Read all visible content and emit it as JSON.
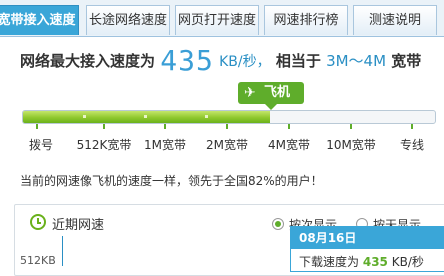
{
  "tabs": [
    {
      "label": "宽带接入速度",
      "active": true
    },
    {
      "label": "长途网络速度",
      "active": false
    },
    {
      "label": "网页打开速度",
      "active": false
    },
    {
      "label": "网速排行榜",
      "active": false
    },
    {
      "label": "测速说明",
      "active": false
    }
  ],
  "headline": {
    "prefix": "网络最大接入速度为",
    "speed": "435",
    "unit": "KB/秒，",
    "middle": "相当于",
    "range": "3M～4M",
    "suffix": "宽带"
  },
  "badge": {
    "icon": "plane-icon",
    "label": "飞机"
  },
  "meter": {
    "progress_percent": 60,
    "scale": [
      "拨号",
      "512K宽带",
      "1M宽带",
      "2M宽带",
      "4M宽带",
      "10M宽带",
      "专线"
    ],
    "fill_color": "#8fc82e"
  },
  "description": "当前的网速像飞机的速度一样，领先于全国82%的用户！",
  "recent": {
    "title": "近期网速",
    "options": [
      {
        "label": "按次显示",
        "selected": true
      },
      {
        "label": "按天显示",
        "selected": false
      }
    ],
    "y_label": "512KB",
    "tooltip": {
      "date": "08月16日",
      "label": "下载速度为",
      "value": "435",
      "unit": "KB/秒"
    }
  },
  "colors": {
    "accent": "#3aa6d8",
    "green": "#5fad2b"
  }
}
